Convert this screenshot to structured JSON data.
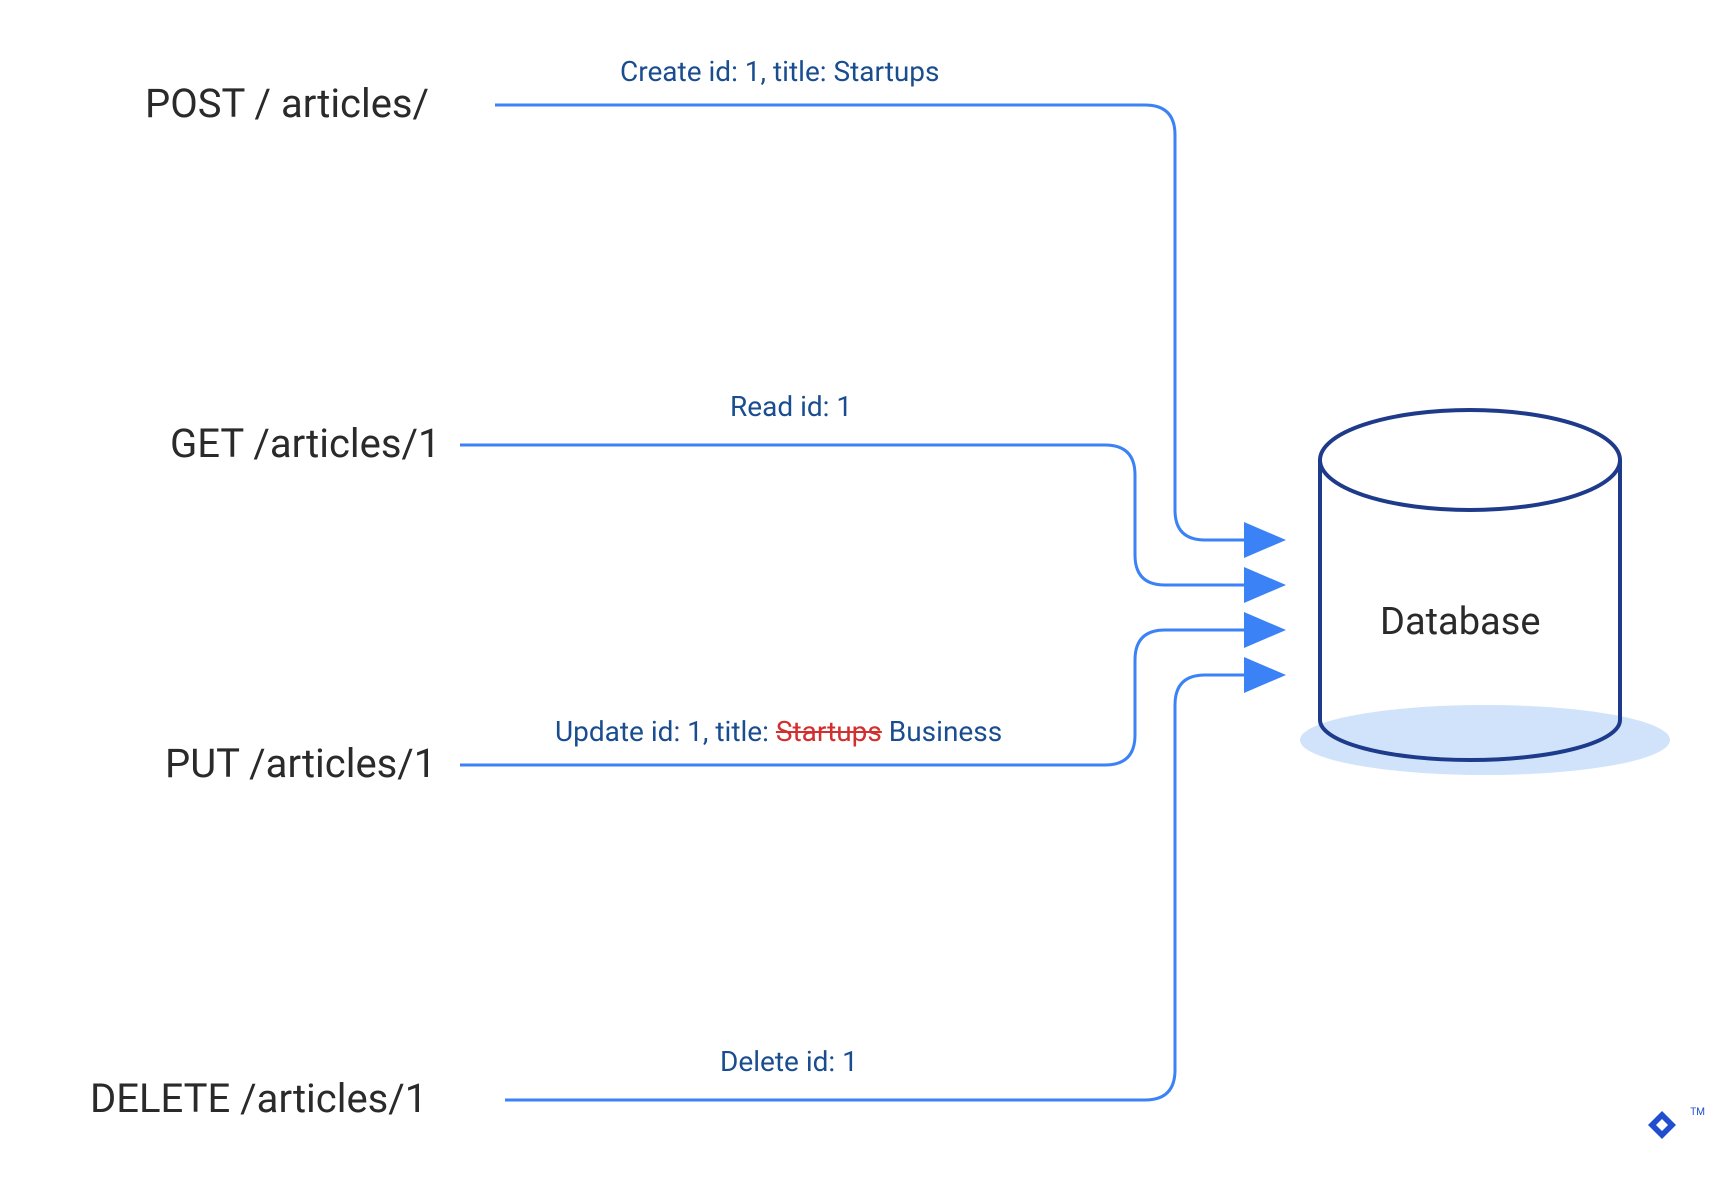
{
  "methods": {
    "post": {
      "label": "POST / articles/",
      "action": "Create id: 1, title: Startups"
    },
    "get": {
      "label": "GET /articles/1",
      "action": "Read id: 1"
    },
    "put": {
      "label": "PUT /articles/1",
      "action_prefix": "Update id: 1, title: ",
      "action_strike": "Startups",
      "action_suffix": " Business"
    },
    "delete": {
      "label": "DELETE /articles/1",
      "action": "Delete id: 1"
    }
  },
  "database": {
    "label": "Database"
  },
  "colors": {
    "line": "#3b82f6",
    "text_dark": "#2a2a2a",
    "text_blue": "#1a4d8f",
    "text_red": "#d32f2f",
    "db_stroke": "#1e3a8a",
    "db_shadow": "#d0e3fb"
  },
  "logo": {
    "tm": "TM"
  }
}
